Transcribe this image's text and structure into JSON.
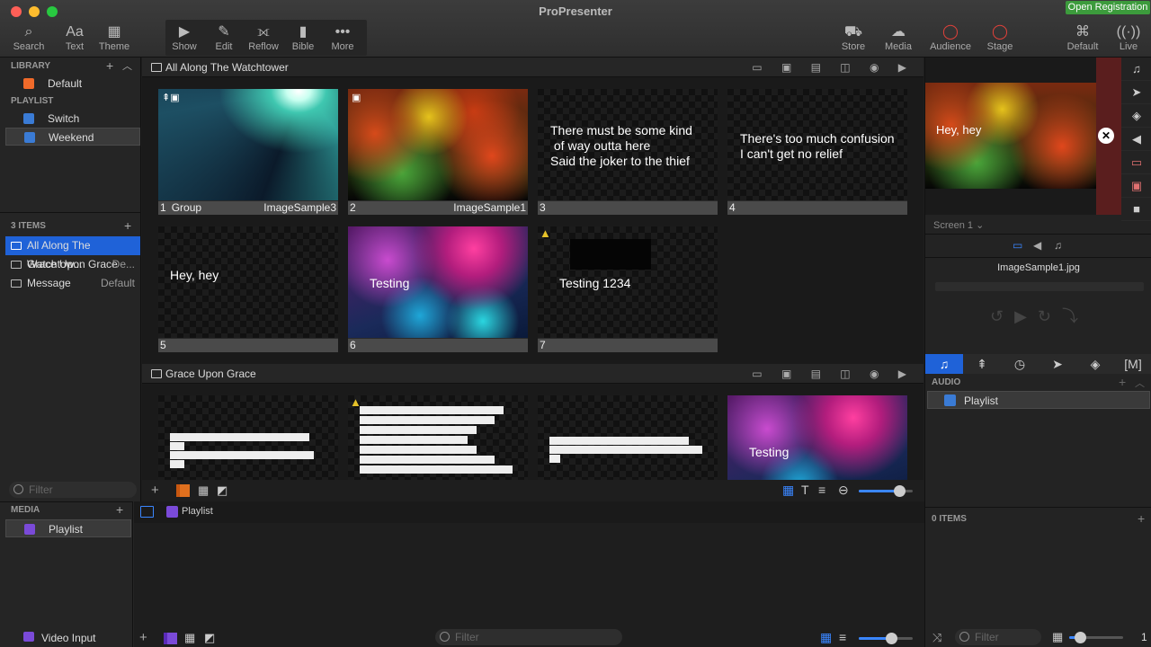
{
  "app": {
    "title": "ProPresenter",
    "registration": "Open Registration"
  },
  "toolbar": {
    "left": [
      {
        "icon": "search-icon",
        "glyph": "⌕",
        "label": "Search"
      },
      {
        "icon": "text-icon",
        "glyph": "Aa",
        "label": "Text"
      },
      {
        "icon": "theme-icon",
        "glyph": "▦",
        "label": "Theme"
      }
    ],
    "middle": [
      {
        "icon": "show-icon",
        "glyph": "▶",
        "label": "Show"
      },
      {
        "icon": "edit-icon",
        "glyph": "✎",
        "label": "Edit"
      },
      {
        "icon": "reflow-icon",
        "glyph": "⟗",
        "label": "Reflow"
      },
      {
        "icon": "bible-icon",
        "glyph": "▮",
        "label": "Bible"
      },
      {
        "icon": "more-icon",
        "glyph": "•••",
        "label": "More"
      }
    ],
    "right": [
      {
        "icon": "store-icon",
        "glyph": "⛟",
        "label": "Store"
      },
      {
        "icon": "media-icon",
        "glyph": "☁",
        "label": "Media"
      },
      {
        "icon": "audience-icon",
        "glyph": "◯",
        "label": "Audience"
      },
      {
        "icon": "stage-icon",
        "glyph": "◯",
        "label": "Stage"
      },
      {
        "icon": "default-icon",
        "glyph": "⌘",
        "label": "Default"
      },
      {
        "icon": "live-icon",
        "glyph": "((·))",
        "label": "Live"
      }
    ]
  },
  "library": {
    "header": "LIBRARY",
    "items": [
      {
        "label": "Default"
      }
    ],
    "playlist_header": "PLAYLIST",
    "playlists": [
      {
        "label": "Switch"
      },
      {
        "label": "Weekend"
      }
    ]
  },
  "items": {
    "header": "3 ITEMS",
    "list": [
      {
        "label": "All Along The Watchtow...",
        "detail": ""
      },
      {
        "label": "Grace Upon Grace",
        "detail": "De..."
      },
      {
        "label": "Message",
        "detail": "Default"
      }
    ],
    "filter_placeholder": "Filter"
  },
  "groups": [
    {
      "title": "All Along The Watchtower",
      "slides": [
        {
          "num": "1",
          "group": "Group",
          "name": "ImageSample3",
          "kind": "rays"
        },
        {
          "num": "2",
          "group": "",
          "name": "ImageSample1",
          "kind": "forest"
        },
        {
          "num": "3",
          "group": "",
          "name": "",
          "kind": "text",
          "text": "There must be some kind\n of way outta here\nSaid the joker to the thief"
        },
        {
          "num": "4",
          "group": "",
          "name": "",
          "kind": "text",
          "text": "There's too much confusion\nI can't get no relief"
        },
        {
          "num": "5",
          "group": "",
          "name": "",
          "kind": "text",
          "text": "Hey, hey"
        },
        {
          "num": "6",
          "group": "",
          "name": "",
          "kind": "bokeh",
          "text": "Testing"
        },
        {
          "num": "7",
          "group": "",
          "name": "",
          "kind": "text",
          "text": "Testing 1234"
        }
      ]
    },
    {
      "title": "Grace Upon Grace",
      "slides": [
        {
          "kind": "bars"
        },
        {
          "kind": "bars2"
        },
        {
          "kind": "bars3"
        },
        {
          "kind": "bokeh",
          "text": "Testing"
        }
      ]
    }
  ],
  "media": {
    "header": "MEDIA",
    "items": [
      {
        "label": "Playlist"
      }
    ],
    "main_label": "Playlist",
    "video_input": "Video Input",
    "filter_placeholder": "Filter"
  },
  "preview": {
    "text": "Hey, hey",
    "screen": "Screen 1",
    "filename": "ImageSample1.jpg"
  },
  "audio": {
    "header": "AUDIO",
    "items": [
      {
        "label": "Playlist"
      }
    ],
    "count": "0 ITEMS",
    "filter_placeholder": "Filter",
    "page": "1"
  },
  "settings": {
    "thumb_zoom": 0.75,
    "media_zoom": 0.6,
    "audio_zoom": 0.2
  }
}
